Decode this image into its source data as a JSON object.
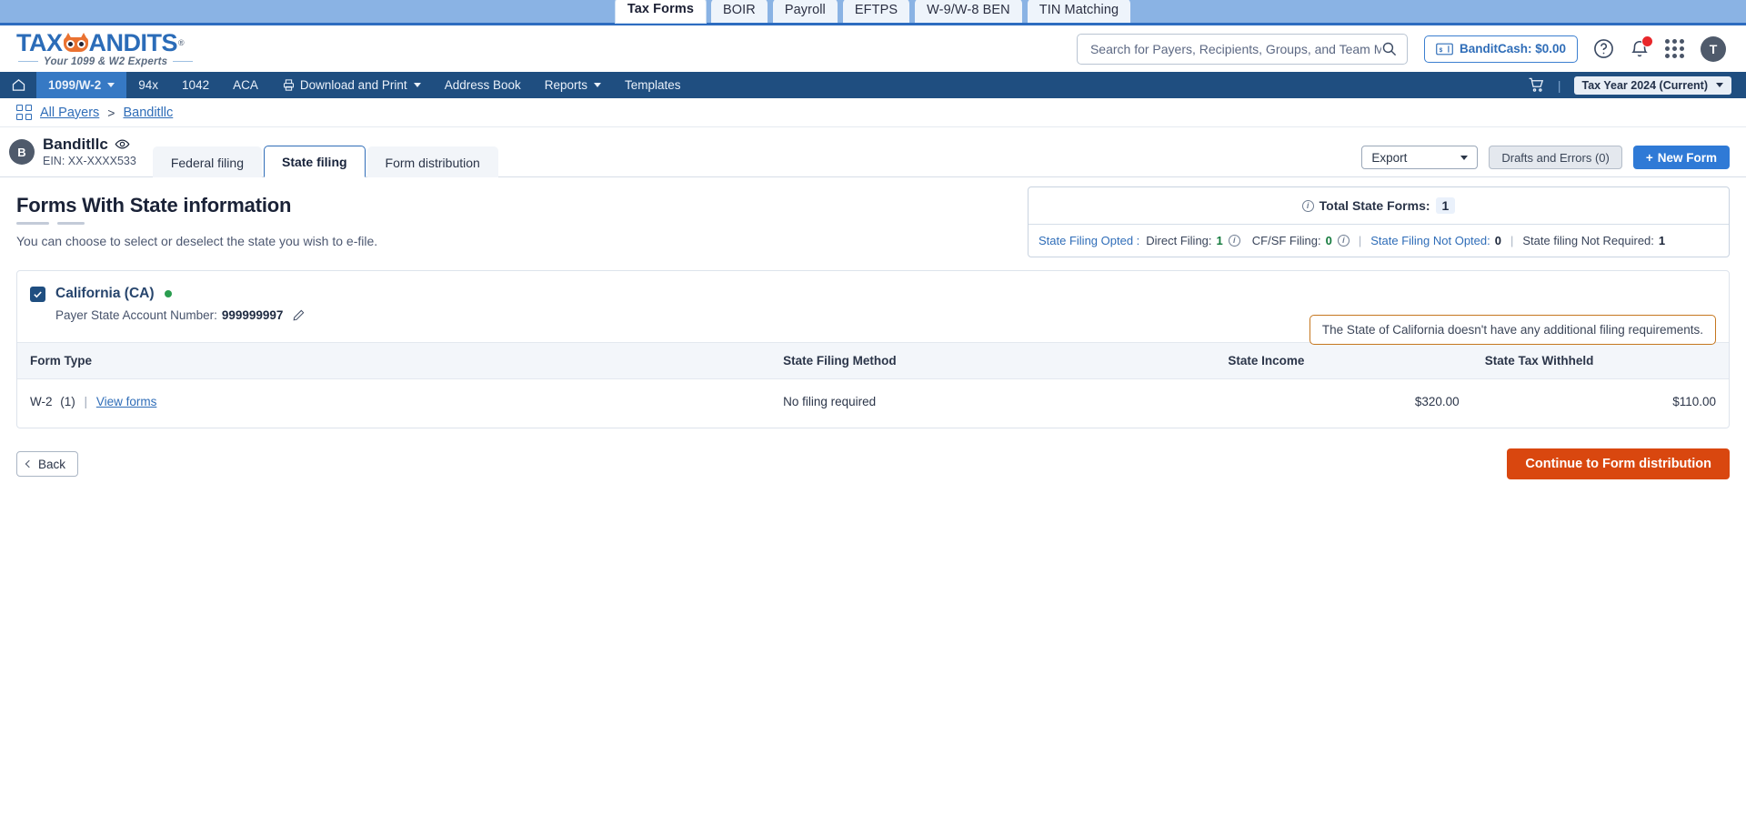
{
  "product_tabs": [
    {
      "label": "Tax Forms",
      "active": true
    },
    {
      "label": "BOIR",
      "active": false
    },
    {
      "label": "Payroll",
      "active": false
    },
    {
      "label": "EFTPS",
      "active": false
    },
    {
      "label": "W-9/W-8 BEN",
      "active": false
    },
    {
      "label": "TIN Matching",
      "active": false
    }
  ],
  "brand": {
    "name_part1": "TAX",
    "name_part2": "ANDITS",
    "tm": "Ⓜ",
    "tagline": "Your 1099 & W2 Experts"
  },
  "search": {
    "placeholder": "Search for Payers, Recipients, Groups, and Team Members",
    "value": "",
    "icon": "search-icon"
  },
  "header": {
    "bandit_cash_label": "BanditCash: $0.00",
    "bandit_cash_icon": "cash-note-icon",
    "help_icon": "question-circle-icon",
    "notifications_icon": "bell-icon",
    "apps_icon": "apps-grid-icon",
    "avatar_initial": "T"
  },
  "mainnav": {
    "home_icon": "home-icon",
    "items": [
      {
        "label": "1099/W-2",
        "caret": true,
        "active": true
      },
      {
        "label": "94x",
        "caret": false,
        "active": false
      },
      {
        "label": "1042",
        "caret": false,
        "active": false
      },
      {
        "label": "ACA",
        "caret": false,
        "active": false
      },
      {
        "label": "Download and Print",
        "caret": true,
        "active": false,
        "icon": "printer-icon"
      },
      {
        "label": "Address Book",
        "caret": false,
        "active": false
      },
      {
        "label": "Reports",
        "caret": true,
        "active": false
      },
      {
        "label": "Templates",
        "caret": false,
        "active": false
      }
    ],
    "cart_icon": "cart-icon",
    "divider": "|",
    "tax_year": "Tax Year 2024 (Current)"
  },
  "breadcrumb": {
    "grid_icon": "grid-squares-icon",
    "root": "All Payers",
    "separator": ">",
    "current": "Banditllc"
  },
  "payer": {
    "avatar_initial": "B",
    "name": "Banditllc",
    "eye_icon": "eye-icon",
    "ein": "EIN: XX-XXXX533",
    "tabs": [
      {
        "label": "Federal filing",
        "active": false
      },
      {
        "label": "State filing",
        "active": true
      },
      {
        "label": "Form distribution",
        "active": false
      }
    ],
    "export_label": "Export",
    "drafts_label": "Drafts and Errors (0)",
    "new_form_label": "New  Form",
    "new_form_plus": "+"
  },
  "page": {
    "title": "Forms With State information",
    "subtitle": "You can choose to select or deselect the state you wish to e-file."
  },
  "summary": {
    "total_label": "Total State Forms:",
    "total_value": "1",
    "info_icon": "info-circle-icon",
    "opted_label": "State Filing Opted :",
    "direct_label": "Direct Filing:",
    "direct_value": "1",
    "cfsf_label": "CF/SF Filing:",
    "cfsf_value": "0",
    "not_opted_label": "State Filing Not Opted:",
    "not_opted_value": "0",
    "not_required_label": "State filing Not Required:",
    "not_required_value": "1"
  },
  "state": {
    "checkbox_checked": true,
    "name": "California (CA)",
    "status_dot_color": "#2a9d4f",
    "account_label": "Payer State Account Number:",
    "account_number": "999999997",
    "edit_icon": "pencil-icon",
    "note": "The State of California doesn't have any additional filing requirements."
  },
  "table": {
    "columns": [
      "Form Type",
      "State Filing Method",
      "State Income",
      "State Tax Withheld"
    ],
    "rows": [
      {
        "form_type": "W-2",
        "form_count": "(1)",
        "separator": "|",
        "view_forms": "View forms",
        "filing_method": "No filing required",
        "state_income": "$320.00",
        "state_tax_withheld": "$110.00"
      }
    ]
  },
  "footer": {
    "back_label": "Back",
    "continue_label": "Continue to Form distribution"
  },
  "colors": {
    "brand_blue": "#2b6cb8",
    "nav_blue": "#1f4e80",
    "accent_orange": "#d9470f",
    "green": "#2a9d4f",
    "note_border": "#c5771f"
  }
}
